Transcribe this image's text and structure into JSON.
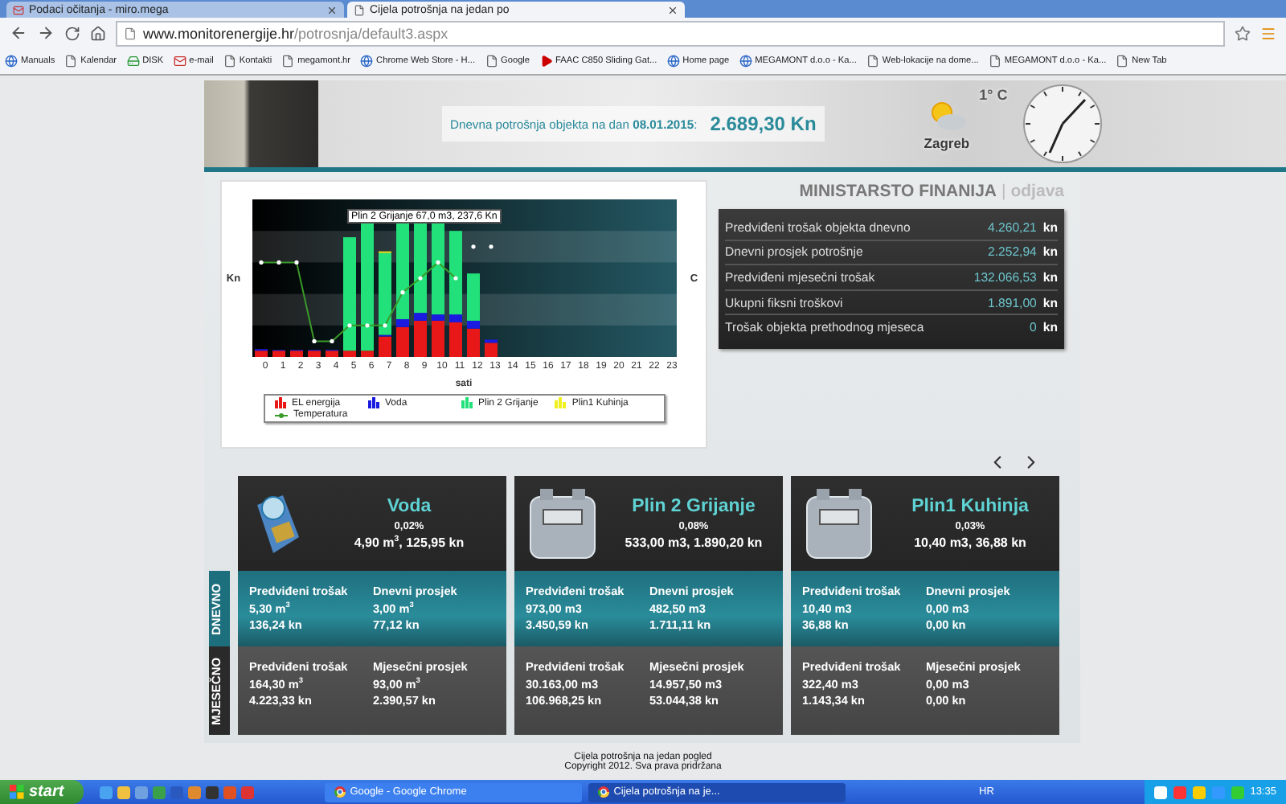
{
  "browser": {
    "tabs": [
      {
        "title": "Podaci očitanja - miro.mega",
        "selected": false,
        "kind": "mail"
      },
      {
        "title": "Cijela potrošnja na jedan po",
        "selected": true,
        "kind": "page"
      }
    ],
    "address": {
      "host": "www.monitorenergije.hr",
      "path": "/potrosnja/default3.aspx"
    },
    "bookmarks": [
      {
        "label": "Manuals",
        "kind": "globe"
      },
      {
        "label": "Kalendar",
        "kind": "page"
      },
      {
        "label": "DISK",
        "kind": "drive"
      },
      {
        "label": "e-mail",
        "kind": "mail"
      },
      {
        "label": "Kontakti",
        "kind": "page"
      },
      {
        "label": "megamont.hr",
        "kind": "page"
      },
      {
        "label": "Chrome Web Store - H...",
        "kind": "globe"
      },
      {
        "label": "Google",
        "kind": "page"
      },
      {
        "label": "FAAC C850 Sliding Gat...",
        "kind": "video"
      },
      {
        "label": "Home page",
        "kind": "globe"
      },
      {
        "label": "MEGAMONT d.o.o - Ka...",
        "kind": "globe"
      },
      {
        "label": "Web-lokacije na dome...",
        "kind": "page"
      },
      {
        "label": "MEGAMONT d.o.o - Ka...",
        "kind": "page"
      },
      {
        "label": "New Tab",
        "kind": "page"
      }
    ]
  },
  "header": {
    "label": "Dnevna potrošnja objekta na dan",
    "date": "08.01.2015",
    "colon": ":",
    "amount": "2.689,30 Kn",
    "weather": {
      "temperature": "1° C",
      "city": "Zagreb"
    }
  },
  "account": {
    "name": "MINISTARSTO FINANIJA",
    "separator": "|",
    "link": "odjava"
  },
  "chart": {
    "tooltip": "Plin 2 Grijanje 67,0 m3, 237,6 Kn",
    "left_label": "Kn",
    "right_label": "C",
    "hours": [
      "0",
      "1",
      "2",
      "3",
      "4",
      "5",
      "6",
      "7",
      "8",
      "9",
      "10",
      "11",
      "12",
      "13",
      "14",
      "15",
      "16",
      "17",
      "18",
      "19",
      "20",
      "21",
      "22",
      "23"
    ],
    "xlabel": "sati",
    "legend": [
      {
        "label": "EL energija",
        "color": "#e81818",
        "kind": "bar"
      },
      {
        "label": "Voda",
        "color": "#1a1ae0",
        "kind": "bar"
      },
      {
        "label": "Plin 2 Grijanje",
        "color": "#22e07a",
        "kind": "bar"
      },
      {
        "label": "Plin1 Kuhinja",
        "color": "#f0f020",
        "kind": "bar"
      },
      {
        "label": "Temperatura",
        "color": "#3a9a2a",
        "kind": "line"
      }
    ]
  },
  "stats": [
    {
      "label": "Predviđeni trošak objekta dnevno",
      "value": "4.260,21",
      "unit": "kn"
    },
    {
      "label": "Dnevni prosjek potrošnje",
      "value": "2.252,94",
      "unit": "kn"
    },
    {
      "label": "Predviđeni mjesečni trošak",
      "value": "132.066,53",
      "unit": "kn"
    },
    {
      "label": "Ukupni fiksni troškovi",
      "value": "1.891,00",
      "unit": "kn"
    },
    {
      "label": "Trošak objekta prethodnog mjeseca",
      "value": "0",
      "unit": "kn"
    }
  ],
  "sections": {
    "daily": "DNEVNO",
    "monthly": "MJESEČNO"
  },
  "meters": [
    {
      "name": "Voda",
      "kind": "water",
      "share": "0,02%",
      "reading": "4,90 m$^{3}$, 125,95 kn",
      "daily": [
        {
          "title": "Predviđeni trošak",
          "lines": [
            "5,30 m$^{3}$",
            "136,24 kn"
          ]
        },
        {
          "title": "Dnevni prosjek",
          "lines": [
            "3,00 m$^{3}$",
            "77,12 kn"
          ]
        }
      ],
      "monthly": [
        {
          "title": "Predviđeni trošak",
          "lines": [
            "164,30 m$^{3}$",
            "4.223,33 kn"
          ]
        },
        {
          "title": "Mjesečni prosjek",
          "lines": [
            "93,00 m$^{3}$",
            "2.390,57 kn"
          ]
        }
      ]
    },
    {
      "name": "Plin 2 Grijanje",
      "kind": "gas",
      "share": "0,08%",
      "reading": "533,00 m3, 1.890,20 kn",
      "daily": [
        {
          "title": "Predviđeni trošak",
          "lines": [
            "973,00 m3",
            "3.450,59 kn"
          ]
        },
        {
          "title": "Dnevni prosjek",
          "lines": [
            "482,50 m3",
            "1.711,11 kn"
          ]
        }
      ],
      "monthly": [
        {
          "title": "Predviđeni trošak",
          "lines": [
            "30.163,00 m3",
            "106.968,25 kn"
          ]
        },
        {
          "title": "Mjesečni prosjek",
          "lines": [
            "14.957,50 m3",
            "53.044,38 kn"
          ]
        }
      ]
    },
    {
      "name": "Plin1 Kuhinja",
      "kind": "gas",
      "share": "0,03%",
      "reading": "10,40 m3, 36,88 kn",
      "daily": [
        {
          "title": "Predviđeni trošak",
          "lines": [
            "10,40 m3",
            "36,88 kn"
          ]
        },
        {
          "title": "Dnevni prosjek",
          "lines": [
            "0,00 m3",
            "0,00 kn"
          ]
        }
      ],
      "monthly": [
        {
          "title": "Predviđeni trošak",
          "lines": [
            "322,40 m3",
            "1.143,34 kn"
          ]
        },
        {
          "title": "Mjesečni prosjek",
          "lines": [
            "0,00 m3",
            "0,00 kn"
          ]
        }
      ]
    }
  ],
  "footer": [
    "Cijela potrošnja na jedan pogled",
    "Copyright 2012. Sva prava pridržana"
  ],
  "taskbar": {
    "start": "start",
    "tasks": [
      {
        "title": "Google - Google Chrome",
        "selected": false
      },
      {
        "title": "Cijela potrošnja na je...",
        "selected": true
      }
    ],
    "language": "HR",
    "time": "13:35"
  }
}
